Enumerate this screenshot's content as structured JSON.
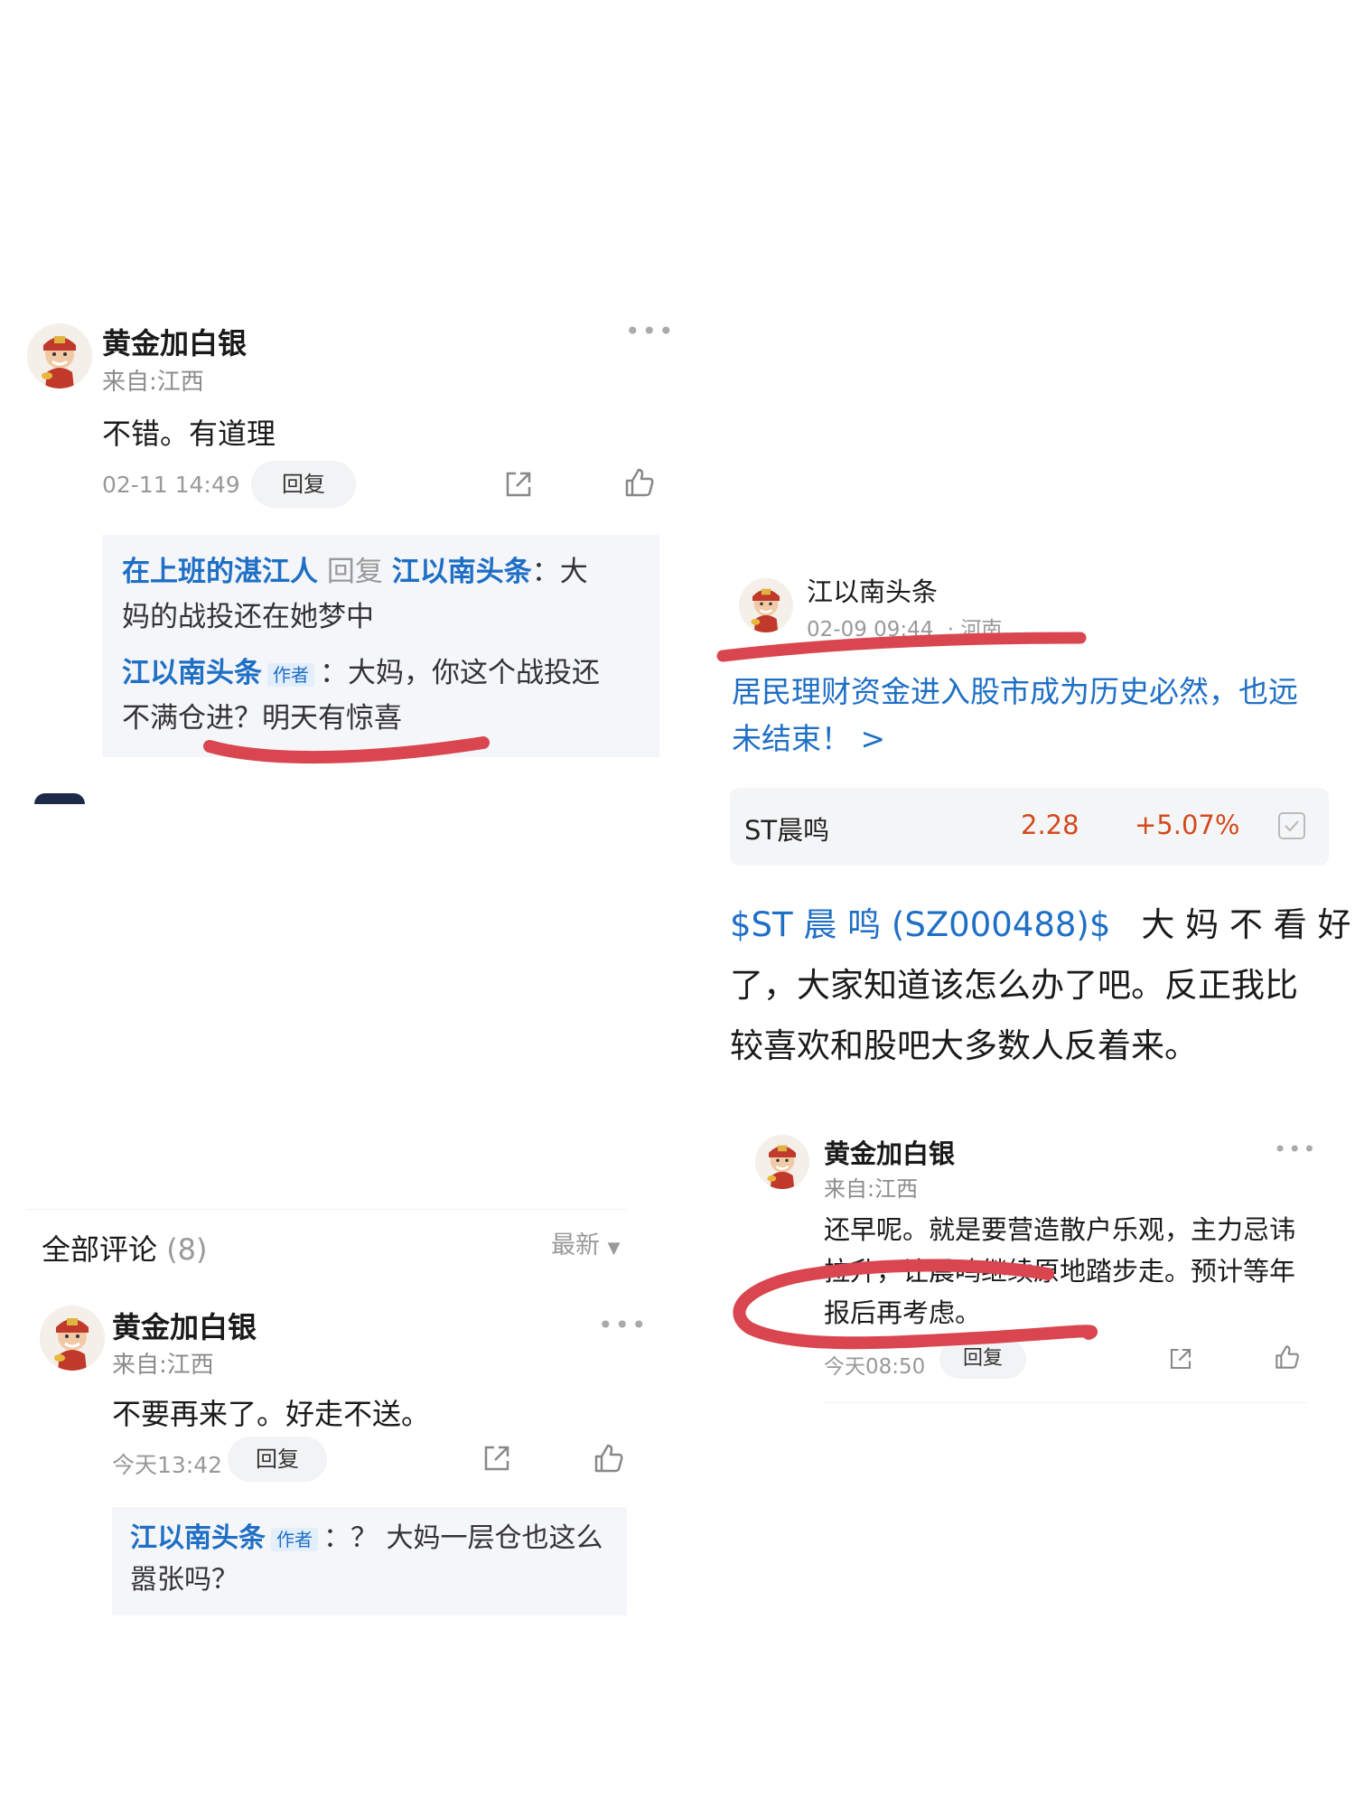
{
  "left_top": {
    "comment": {
      "username": "黄金加白银",
      "location": "来自:江西",
      "text": "不错。有道理",
      "time": "02-11 14:49",
      "reply_label": "回复"
    },
    "sub_replies": [
      {
        "user": "在上班的湛江人",
        "verb": "回复",
        "target": "江以南头条",
        "text_line1": "：大",
        "text_line2": "妈的战投还在她梦中"
      },
      {
        "user": "江以南头条",
        "tag": "作者",
        "text_line1": "：大妈，你这个战投还",
        "text_line2": "不满仓进？明天有惊喜"
      }
    ]
  },
  "left_bottom": {
    "section_title": "全部评论",
    "section_count": "(8)",
    "sort_label": "最新",
    "comment": {
      "username": "黄金加白银",
      "location": "来自:江西",
      "text": "不要再来了。好走不送。",
      "time": "今天13:42",
      "reply_label": "回复"
    },
    "sub_reply": {
      "user": "江以南头条",
      "tag": "作者",
      "text_line1": "：？ 大妈一层仓也这么",
      "text_line2": "嚣张吗？"
    }
  },
  "right": {
    "post": {
      "author": "江以南头条",
      "time": "02-09 09:44",
      "location": "· 河南",
      "title_line1": "居民理财资金进入股市成为历史必然，也远",
      "title_line2": "未结束！ >",
      "stock": {
        "name": "ST晨鸣",
        "price": "2.28",
        "change": "+5.07%"
      },
      "body_link": "$ST 晨 鸣 (SZ000488)$",
      "body_line1_rest": "大 妈 不 看 好",
      "body_line2": "了，大家知道该怎么办了吧。反正我比",
      "body_line3": "较喜欢和股吧大多数人反着来。"
    },
    "comment": {
      "username": "黄金加白银",
      "location": "来自:江西",
      "text": "还早呢。就是要营造散户乐观，主力忌讳拉升，让晨鸣继续原地踏步走。预计等年报后再考虑。",
      "time": "今天08:50",
      "reply_label": "回复"
    }
  },
  "colors": {
    "link_blue": "#1f6fc5",
    "price_red": "#d4491c",
    "annotation_red": "#d9464f"
  }
}
